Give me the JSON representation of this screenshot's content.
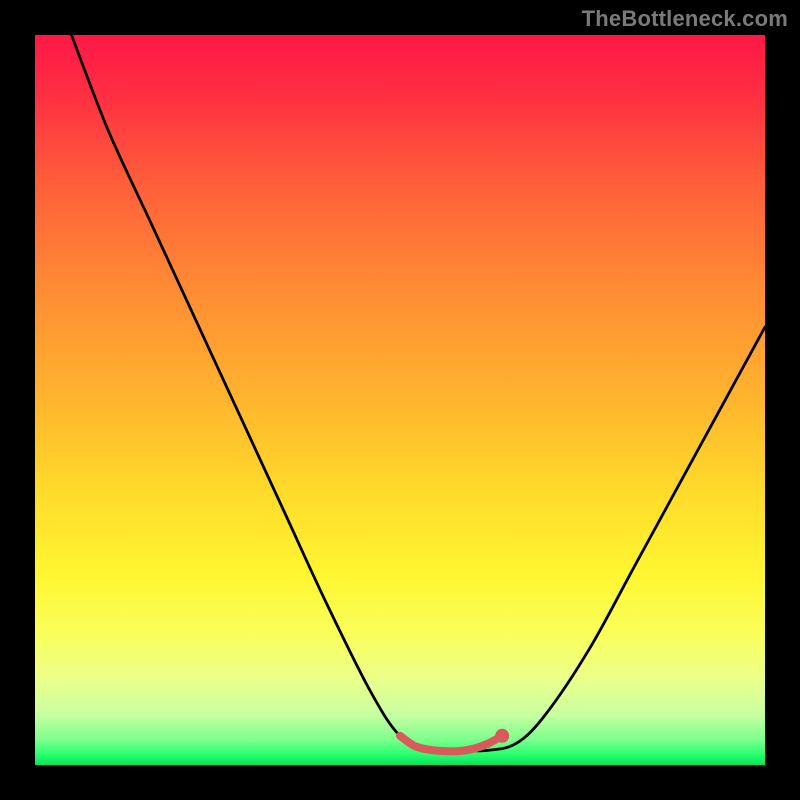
{
  "watermark": "TheBottleneck.com",
  "chart_data": {
    "type": "line",
    "title": "",
    "xlabel": "",
    "ylabel": "",
    "xlim": [
      0,
      100
    ],
    "ylim": [
      0,
      100
    ],
    "background_gradient": {
      "top_color": "#ff1846",
      "mid_color": "#ffe22e",
      "bottom_color": "#07e25c"
    },
    "series": [
      {
        "name": "main-curve",
        "color": "#000000",
        "x": [
          5,
          10,
          16,
          22,
          28,
          34,
          40,
          46,
          50,
          54,
          58,
          62,
          66,
          70,
          76,
          82,
          88,
          94,
          100
        ],
        "values": [
          100,
          87,
          74,
          61,
          48,
          35,
          22,
          10,
          4,
          2,
          2,
          2,
          3,
          7,
          16,
          27,
          38,
          49,
          60
        ]
      },
      {
        "name": "flat-highlight",
        "color": "#d95a5a",
        "x": [
          50,
          52,
          54,
          56,
          58,
          60,
          62,
          64
        ],
        "values": [
          4,
          2.6,
          2.1,
          1.9,
          1.9,
          2.2,
          2.9,
          4.0
        ]
      }
    ],
    "marker": {
      "x": 64,
      "y": 4.0,
      "color": "#d95a5a"
    }
  }
}
